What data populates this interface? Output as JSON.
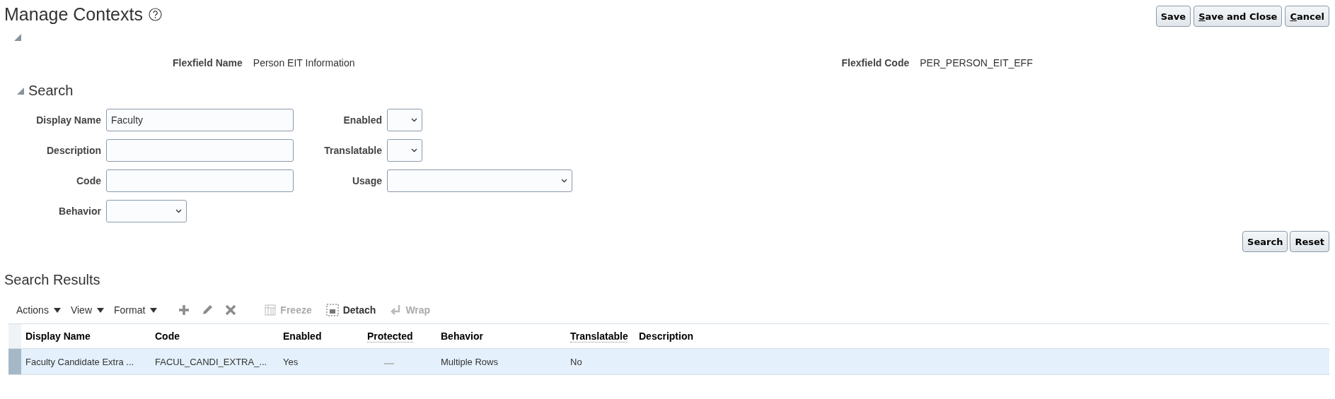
{
  "page": {
    "title": "Manage Contexts"
  },
  "actions": [
    {
      "label_rest": "Save"
    },
    {
      "label_key": "S",
      "label_rest": "ave and Close"
    },
    {
      "label_key": "C",
      "label_rest": "ancel"
    }
  ],
  "header_section": {
    "expanded": true,
    "fields": [
      {
        "label": "Flexfield Name",
        "value": "Person EIT Information"
      },
      {
        "label": "Flexfield Code",
        "value": "PER_PERSON_EIT_EFF"
      }
    ]
  },
  "search": {
    "title": "Search",
    "expanded": true,
    "left_fields": [
      {
        "kind": "text",
        "label": "Display Name",
        "value": "Faculty"
      },
      {
        "kind": "text",
        "label": "Description"
      },
      {
        "kind": "text",
        "label": "Code"
      },
      {
        "kind": "select",
        "label": "Behavior"
      }
    ],
    "right_fields": [
      {
        "kind": "yesno",
        "label": "Enabled"
      },
      {
        "kind": "yesno",
        "label": "Translatable"
      },
      {
        "kind": "list",
        "label": "Usage"
      }
    ],
    "buttons": [
      "Search",
      "Reset"
    ]
  },
  "results": {
    "title": "Search Results",
    "menus": [
      "Actions",
      "View",
      "Format"
    ],
    "tools": [
      {
        "kind": "add",
        "disabled": false
      },
      {
        "kind": "edit",
        "disabled": false
      },
      {
        "kind": "delete",
        "disabled": false
      }
    ],
    "toggles": [
      {
        "kind": "freeze",
        "label": "Freeze",
        "disabled": true
      },
      {
        "kind": "detach",
        "label": "Detach",
        "disabled": false
      },
      {
        "kind": "wrap",
        "label": "Wrap",
        "disabled": true
      }
    ],
    "columns": [
      {
        "label": "Display Name",
        "dotted": false
      },
      {
        "label": "Code",
        "dotted": false
      },
      {
        "label": "Enabled",
        "dotted": false
      },
      {
        "label": "Protected",
        "dotted": true
      },
      {
        "label": "Behavior",
        "dotted": false
      },
      {
        "label": "Translatable",
        "dotted": true
      },
      {
        "label": "Description",
        "dotted": false
      }
    ],
    "rows": [
      {
        "selected": true,
        "display_name": "Faculty Candidate Extra ...",
        "code": "FACUL_CANDI_EXTRA_...",
        "enabled": "Yes",
        "protected": false,
        "behavior": "Multiple Rows",
        "translatable": "No"
      }
    ]
  }
}
